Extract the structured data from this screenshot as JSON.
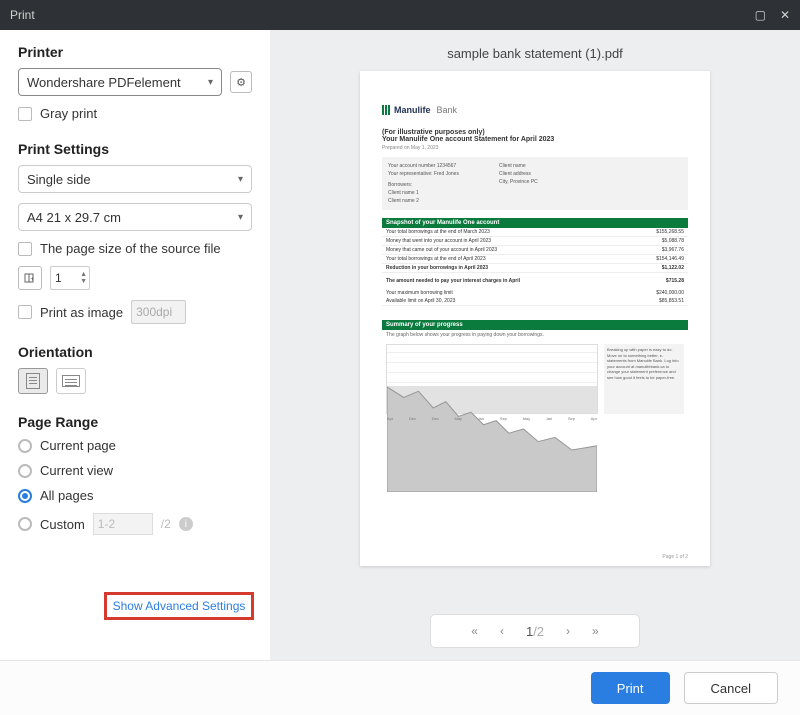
{
  "titlebar": {
    "title": "Print"
  },
  "printer": {
    "label": "Printer",
    "selected": "Wondershare PDFelement",
    "gray_print": "Gray print"
  },
  "print_settings": {
    "label": "Print Settings",
    "side_selected": "Single side",
    "paper_selected": "A4 21 x 29.7 cm",
    "source_size": "The page size of the source file",
    "copies": "1",
    "print_as_image": "Print as image",
    "dpi_placeholder": "300dpi"
  },
  "orientation": {
    "label": "Orientation"
  },
  "page_range": {
    "label": "Page Range",
    "options": {
      "current_page": "Current page",
      "current_view": "Current view",
      "all_pages": "All pages",
      "custom": "Custom"
    },
    "custom_placeholder": "1-2",
    "total_pages_suffix": "/2"
  },
  "advanced_link": "Show Advanced Settings",
  "preview": {
    "filename": "sample bank statement (1).pdf",
    "logo_text": "Manulife",
    "logo_suffix": "Bank",
    "illustrative": "(For illustrative purposes only)",
    "statement_title": "Your Manulife One account Statement for April 2023",
    "prepared": "Prepared on May 1, 2023",
    "account_left": {
      "a": "Your account number 1234567",
      "b": "Your representative: Fred Jones",
      "c": "Borrowers:",
      "d": "Client name 1",
      "e": "Client name 2"
    },
    "account_right": {
      "a": "Client name",
      "b": "Client address",
      "c": "City, Province PC"
    },
    "snapshot_header": "Snapshot of your Manulife One account",
    "snapshot_rows": [
      {
        "l": "Your total borrowings at the end of March 2023",
        "r": "$155,268.55"
      },
      {
        "l": "Money that went into your account in April 2023",
        "r": "$5,088.78"
      },
      {
        "l": "Money that came out of your account in April 2023",
        "r": "$3,967.76"
      },
      {
        "l": "Your total borrowings at the end of April 2023",
        "r": "$154,146.49"
      },
      {
        "l": "Reduction in your borrowings in April 2023",
        "r": "$1,122.02"
      },
      {
        "l": "The amount needed to pay your interest charges in April",
        "r": "$715.28"
      },
      {
        "l": "Your maximum borrowing limit",
        "r": "$240,000.00"
      },
      {
        "l": "Available limit on April 30, 2023",
        "r": "$85,853.51"
      }
    ],
    "progress_header": "Summary of your progress",
    "progress_note": "The graph below shows your progress in paying down your borrowings.",
    "months": [
      "Apr",
      "Dec",
      "Dec",
      "May",
      "Jan",
      "Sep",
      "May",
      "Jan",
      "Sep",
      "Apr"
    ],
    "sidebox": "Breaking up with paper is easy to do. Move on to something better, e-statements from Manulife Bank. Log into your account at manulifebank.ca to change your statement preference and see how good it feels to be paper-free.",
    "page_indicator": "Page 1 of 2"
  },
  "pager": {
    "current": "1",
    "total": "/2"
  },
  "footer": {
    "print": "Print",
    "cancel": "Cancel"
  }
}
